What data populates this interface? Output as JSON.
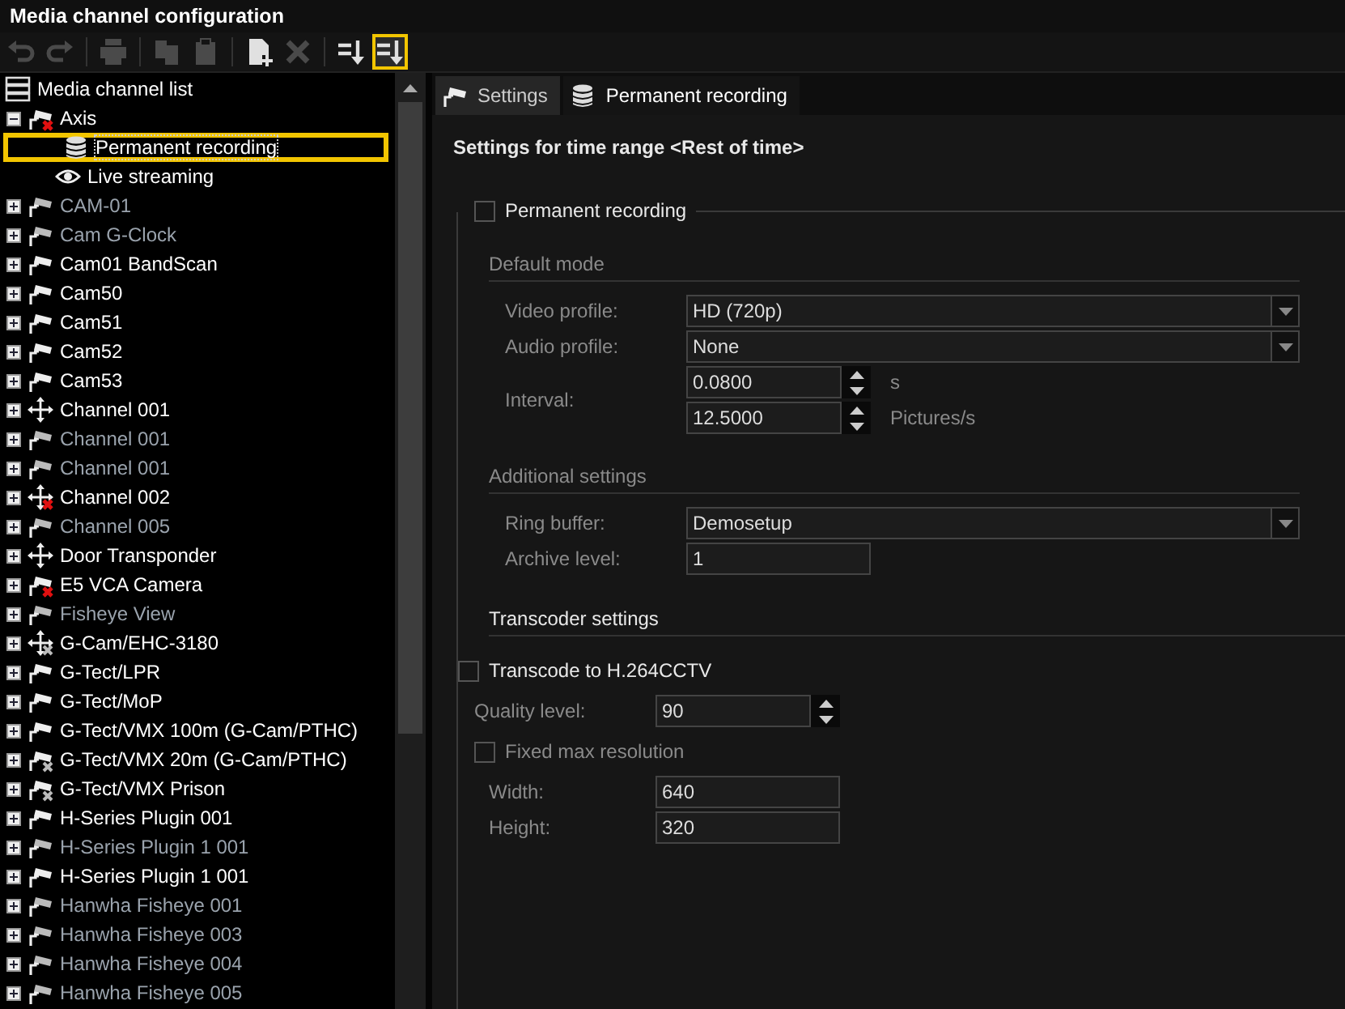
{
  "window": {
    "title": "Media channel configuration"
  },
  "toolbar": [
    {
      "kind": "undo",
      "disabled": true,
      "selected": false
    },
    {
      "kind": "redo",
      "disabled": true,
      "selected": false
    },
    {
      "kind": "print",
      "disabled": true,
      "selected": false
    },
    {
      "kind": "copy",
      "disabled": true,
      "selected": false
    },
    {
      "kind": "paste",
      "disabled": true,
      "selected": false
    },
    {
      "kind": "new",
      "disabled": false,
      "selected": false
    },
    {
      "kind": "delete",
      "disabled": true,
      "selected": false
    },
    {
      "kind": "sort",
      "disabled": false,
      "selected": false
    },
    {
      "kind": "sort",
      "disabled": false,
      "selected": true
    }
  ],
  "tree": {
    "root": "Media channel list",
    "items": [
      {
        "label": "Axis",
        "kind": "camera-error",
        "dimmed": false,
        "expanded": true,
        "selected": false,
        "children": [
          {
            "label": "Permanent recording",
            "kind": "database",
            "selected": true
          },
          {
            "label": "Live streaming",
            "kind": "eye",
            "selected": false
          }
        ]
      },
      {
        "label": "CAM-01",
        "kind": "camera",
        "dimmed": true,
        "expanded": false,
        "selected": false
      },
      {
        "label": "Cam G-Clock",
        "kind": "camera",
        "dimmed": true,
        "expanded": false,
        "selected": false
      },
      {
        "label": "Cam01 BandScan",
        "kind": "camera",
        "dimmed": false,
        "expanded": false,
        "selected": false
      },
      {
        "label": "Cam50",
        "kind": "camera",
        "dimmed": false,
        "expanded": false,
        "selected": false
      },
      {
        "label": "Cam51",
        "kind": "camera",
        "dimmed": false,
        "expanded": false,
        "selected": false
      },
      {
        "label": "Cam52",
        "kind": "camera",
        "dimmed": false,
        "expanded": false,
        "selected": false
      },
      {
        "label": "Cam53",
        "kind": "camera",
        "dimmed": false,
        "expanded": false,
        "selected": false
      },
      {
        "label": "Channel 001",
        "kind": "ptz",
        "dimmed": false,
        "expanded": false,
        "selected": false
      },
      {
        "label": "Channel 001",
        "kind": "camera",
        "dimmed": true,
        "expanded": false,
        "selected": false
      },
      {
        "label": "Channel 001",
        "kind": "camera",
        "dimmed": true,
        "expanded": false,
        "selected": false
      },
      {
        "label": "Channel 002",
        "kind": "ptz-error",
        "dimmed": false,
        "expanded": false,
        "selected": false
      },
      {
        "label": "Channel 005",
        "kind": "camera",
        "dimmed": true,
        "expanded": false,
        "selected": false
      },
      {
        "label": "Door Transponder",
        "kind": "ptz",
        "dimmed": false,
        "expanded": false,
        "selected": false
      },
      {
        "label": "E5 VCA Camera",
        "kind": "camera-error",
        "dimmed": false,
        "expanded": false,
        "selected": false
      },
      {
        "label": "Fisheye View",
        "kind": "camera",
        "dimmed": true,
        "expanded": false,
        "selected": false
      },
      {
        "label": "G-Cam/EHC-3180",
        "kind": "ptz-off",
        "dimmed": false,
        "expanded": false,
        "selected": false
      },
      {
        "label": "G-Tect/LPR",
        "kind": "camera",
        "dimmed": false,
        "expanded": false,
        "selected": false
      },
      {
        "label": "G-Tect/MoP",
        "kind": "camera",
        "dimmed": false,
        "expanded": false,
        "selected": false
      },
      {
        "label": "G-Tect/VMX 100m (G-Cam/PTHC)",
        "kind": "camera",
        "dimmed": false,
        "expanded": false,
        "selected": false
      },
      {
        "label": "G-Tect/VMX 20m (G-Cam/PTHC)",
        "kind": "camera-off",
        "dimmed": false,
        "expanded": false,
        "selected": false
      },
      {
        "label": "G-Tect/VMX Prison",
        "kind": "camera-off",
        "dimmed": false,
        "expanded": false,
        "selected": false
      },
      {
        "label": "H-Series Plugin 001",
        "kind": "camera",
        "dimmed": false,
        "expanded": false,
        "selected": false
      },
      {
        "label": "H-Series Plugin 1 001",
        "kind": "camera",
        "dimmed": true,
        "expanded": false,
        "selected": false
      },
      {
        "label": "H-Series Plugin 1 001",
        "kind": "camera",
        "dimmed": false,
        "expanded": false,
        "selected": false
      },
      {
        "label": "Hanwha Fisheye 001",
        "kind": "camera",
        "dimmed": true,
        "expanded": false,
        "selected": false
      },
      {
        "label": "Hanwha Fisheye 003",
        "kind": "camera",
        "dimmed": true,
        "expanded": false,
        "selected": false
      },
      {
        "label": "Hanwha Fisheye 004",
        "kind": "camera",
        "dimmed": true,
        "expanded": false,
        "selected": false
      },
      {
        "label": "Hanwha Fisheye 005",
        "kind": "camera",
        "dimmed": true,
        "expanded": false,
        "selected": false
      }
    ]
  },
  "tabs": [
    {
      "label": "Settings",
      "kind": "camera",
      "selected": false
    },
    {
      "label": "Permanent recording",
      "kind": "database",
      "selected": true
    }
  ],
  "heading": "Settings for time range <Rest of time>",
  "recording_checkbox": {
    "label": "Permanent recording",
    "checked": false
  },
  "sections": [
    {
      "title": "Default mode",
      "disabled": true,
      "items": [
        {
          "kind": "dropdown",
          "label": "Video profile:",
          "value": "HD (720p)",
          "disabled": true
        },
        {
          "kind": "dropdown",
          "label": "Audio profile:",
          "value": "None",
          "disabled": true
        },
        {
          "kind": "spin_group",
          "label": "Interval:",
          "disabled": true,
          "spins": [
            {
              "value": "0.0800",
              "unit": "s"
            },
            {
              "value": "12.5000",
              "unit": "Pictures/s"
            }
          ]
        }
      ]
    },
    {
      "title": "Additional settings",
      "disabled": true,
      "items": [
        {
          "kind": "dropdown",
          "label": "Ring buffer:",
          "value": "Demosetup",
          "disabled": true
        },
        {
          "kind": "text",
          "label": "Archive level:",
          "value": "1",
          "disabled": true
        }
      ]
    },
    {
      "title": "Transcoder settings",
      "disabled": false,
      "items": [
        {
          "kind": "checkbox",
          "label": "Transcode to H.264CCTV",
          "checked": false,
          "disabled": false
        },
        {
          "kind": "spin",
          "label": "Quality level:",
          "value": "90",
          "disabled": true
        },
        {
          "kind": "checkbox",
          "label": "Fixed max resolution",
          "checked": false,
          "disabled": true,
          "children": [
            {
              "kind": "text",
              "label": "Width:",
              "value": "640",
              "disabled": true
            },
            {
              "kind": "text",
              "label": "Height:",
              "value": "320",
              "disabled": true
            }
          ]
        }
      ]
    }
  ]
}
